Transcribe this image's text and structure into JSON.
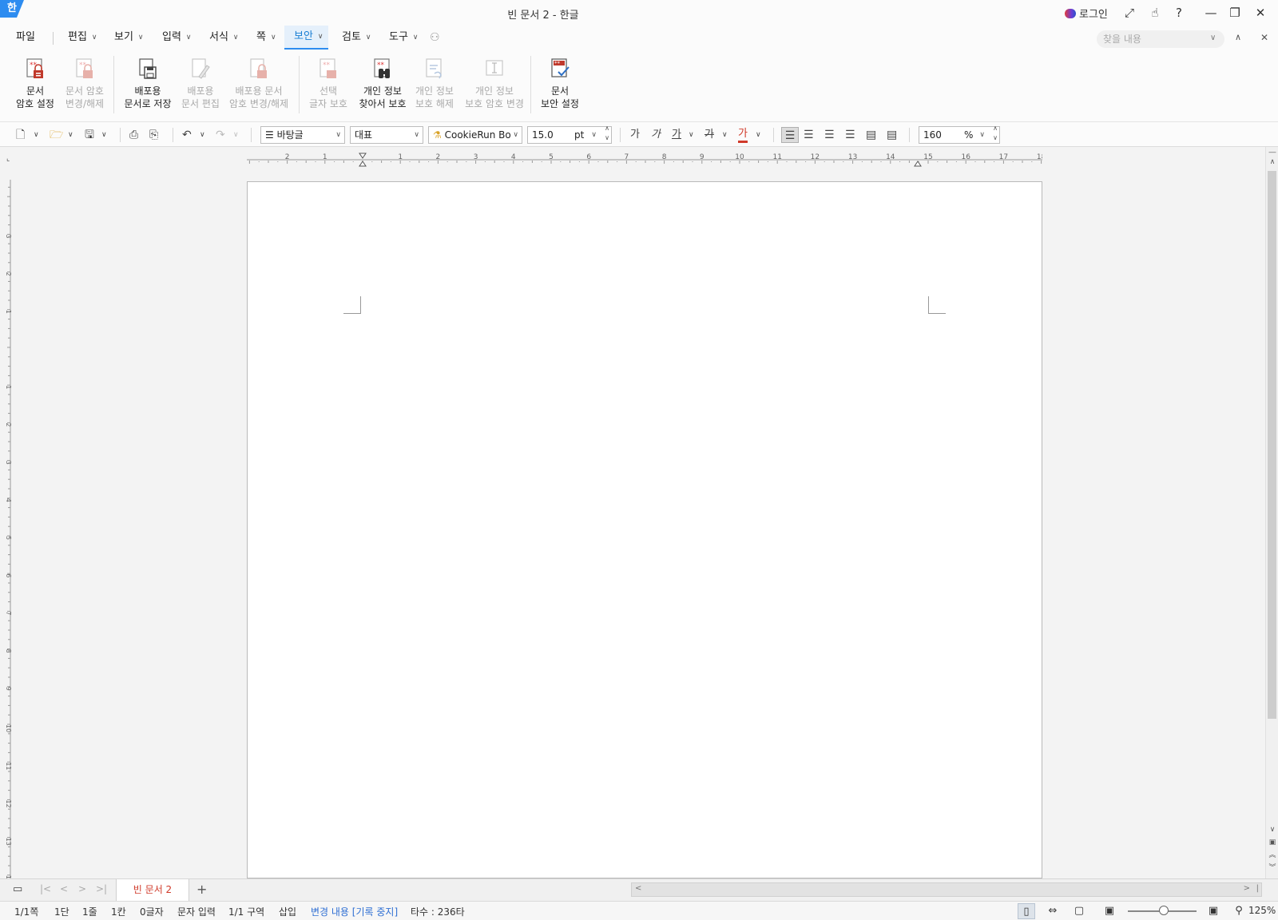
{
  "app": {
    "logo": "한",
    "title": "빈 문서 2 - 한글",
    "login_label": "로그인"
  },
  "window_icons": [
    "expand-icon",
    "touch-icon",
    "help-icon",
    "minimize-icon",
    "restore-icon",
    "close-icon"
  ],
  "menu": {
    "items": [
      {
        "label": "파일",
        "has_dropdown": false
      },
      {
        "label": "편집",
        "has_dropdown": true
      },
      {
        "label": "보기",
        "has_dropdown": true
      },
      {
        "label": "입력",
        "has_dropdown": true
      },
      {
        "label": "서식",
        "has_dropdown": true
      },
      {
        "label": "쪽",
        "has_dropdown": true
      },
      {
        "label": "보안",
        "has_dropdown": true,
        "active": true
      },
      {
        "label": "검토",
        "has_dropdown": true
      },
      {
        "label": "도구",
        "has_dropdown": true
      }
    ],
    "find_placeholder": "찾을 내용"
  },
  "ribbon": {
    "buttons": [
      {
        "line1": "문서",
        "line2": "암호 설정",
        "enabled": true
      },
      {
        "line1": "문서 암호",
        "line2": "변경/해제",
        "enabled": false
      },
      {
        "line1": "배포용",
        "line2": "문서로 저장",
        "enabled": true
      },
      {
        "line1": "배포용",
        "line2": "문서 편집",
        "enabled": false
      },
      {
        "line1": "배포용 문서",
        "line2": "암호 변경/해제",
        "enabled": false
      },
      {
        "line1": "선택",
        "line2": "글자 보호",
        "enabled": false
      },
      {
        "line1": "개인 정보",
        "line2": "찾아서 보호",
        "enabled": true
      },
      {
        "line1": "개인 정보",
        "line2": "보호 해제",
        "enabled": false
      },
      {
        "line1": "개인 정보",
        "line2": "보호 암호 변경",
        "enabled": false
      },
      {
        "line1": "문서",
        "line2": "보안 설정",
        "enabled": true
      }
    ]
  },
  "toolbar": {
    "style": "바탕글",
    "font_language": "대표",
    "font_name": "CookieRun Bo",
    "font_size": "15.0",
    "font_unit": "pt",
    "char_styles": [
      "가",
      "가",
      "가",
      "가",
      "가"
    ],
    "line_spacing": "160",
    "line_spacing_unit": "%"
  },
  "ruler": {
    "h_labels": [
      "2",
      "1",
      "1",
      "2",
      "3",
      "4",
      "5",
      "6",
      "7",
      "8",
      "9",
      "10",
      "11",
      "12",
      "13",
      "14",
      "15",
      "16",
      "17",
      "18"
    ],
    "v_labels": [
      "3",
      "2",
      "1",
      "1",
      "2",
      "3",
      "4",
      "5",
      "6",
      "7",
      "8",
      "9",
      "10",
      "11",
      "12",
      "13",
      "14"
    ]
  },
  "tabs": {
    "doc_tab": "빈 문서 2",
    "add_label": "+"
  },
  "status": {
    "page": "1/1쪽",
    "column": "1단",
    "line": "1줄",
    "cell": "1칸",
    "chars": "0글자",
    "input_mode": "문자 입력",
    "section": "1/1 구역",
    "insert_mode": "삽입",
    "track_changes": "변경 내용 [기록 중지]",
    "keystrokes": "타수 : 236타",
    "zoom": "125%"
  },
  "colors": {
    "accent": "#2d8cf0",
    "active_tab_text": "#d03a2a",
    "status_link": "#2f6fd3",
    "disabled_text": "#a9a9a9"
  }
}
